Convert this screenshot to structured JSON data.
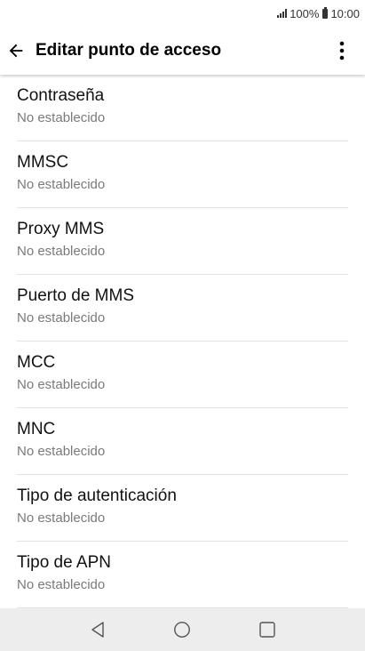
{
  "status_bar": {
    "battery_text": "100%",
    "time": "10:00",
    "icons": [
      "signal-icon",
      "battery-icon"
    ]
  },
  "app_bar": {
    "title": "Editar punto de acceso",
    "back_icon": "arrow-back-icon",
    "more_icon": "more-vert-icon"
  },
  "settings": [
    {
      "title": "Contraseña",
      "summary": "No establecido"
    },
    {
      "title": "MMSC",
      "summary": "No establecido"
    },
    {
      "title": "Proxy MMS",
      "summary": "No establecido"
    },
    {
      "title": "Puerto de MMS",
      "summary": "No establecido"
    },
    {
      "title": "MCC",
      "summary": "No establecido"
    },
    {
      "title": "MNC",
      "summary": "No establecido"
    },
    {
      "title": "Tipo de autenticación",
      "summary": "No establecido"
    },
    {
      "title": "Tipo de APN",
      "summary": "No establecido"
    }
  ],
  "nav_bar": {
    "icons": [
      "nav-back-icon",
      "nav-home-icon",
      "nav-recents-icon"
    ]
  }
}
